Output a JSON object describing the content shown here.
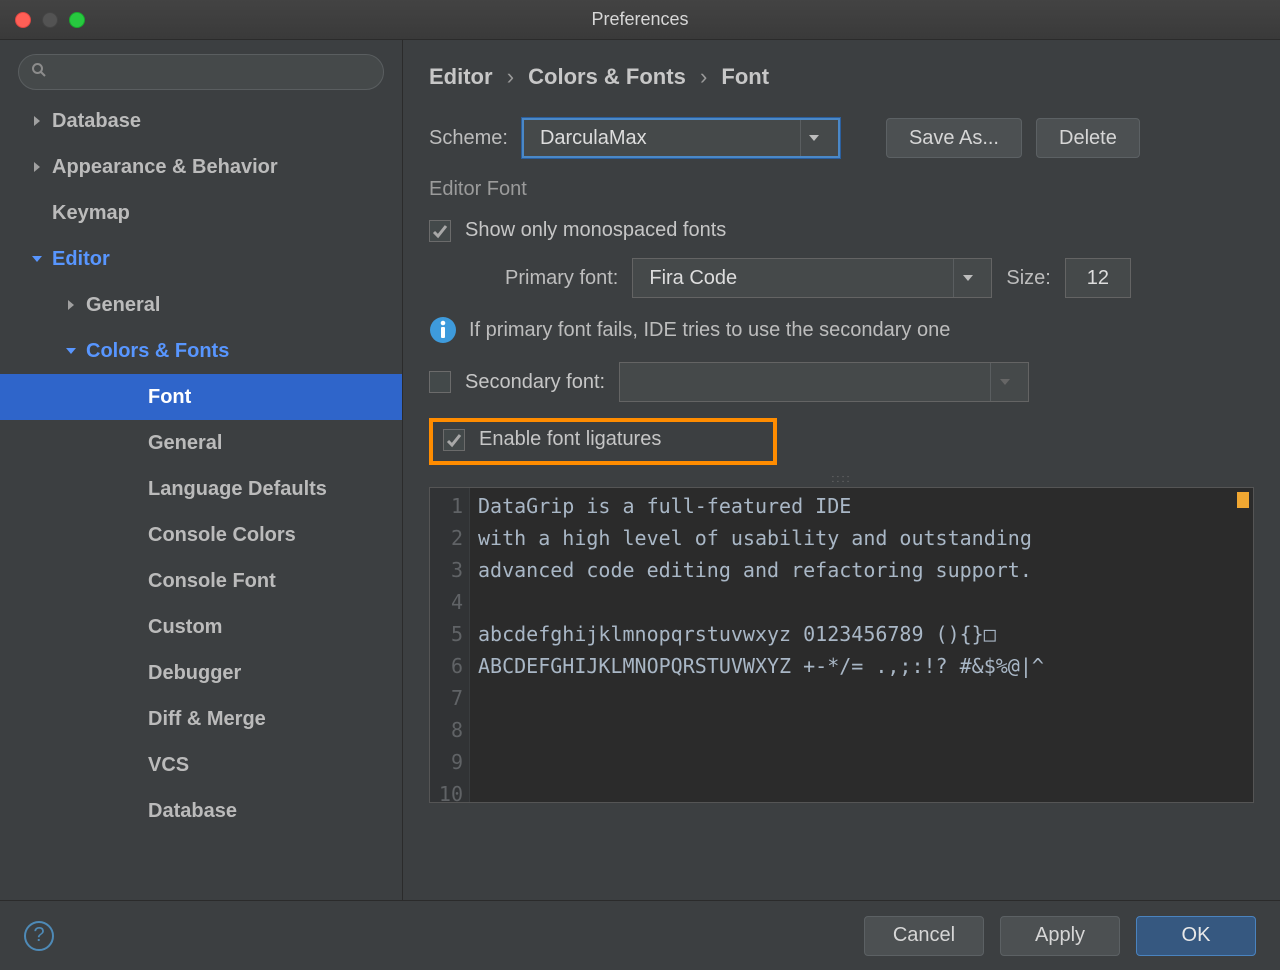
{
  "window": {
    "title": "Preferences"
  },
  "sidebar": {
    "search_placeholder": "",
    "items": [
      {
        "label": "Database",
        "level": 1,
        "arrow": "right"
      },
      {
        "label": "Appearance & Behavior",
        "level": 1,
        "arrow": "right"
      },
      {
        "label": "Keymap",
        "level": 1,
        "arrow": "none"
      },
      {
        "label": "Editor",
        "level": 1,
        "arrow": "down",
        "active_path": true
      },
      {
        "label": "General",
        "level": 2,
        "arrow": "right"
      },
      {
        "label": "Colors & Fonts",
        "level": 2,
        "arrow": "down",
        "active_path": true
      },
      {
        "label": "Font",
        "level": 3,
        "arrow": "none",
        "selected": true
      },
      {
        "label": "General",
        "level": 3,
        "arrow": "none"
      },
      {
        "label": "Language Defaults",
        "level": 3,
        "arrow": "none"
      },
      {
        "label": "Console Colors",
        "level": 3,
        "arrow": "none"
      },
      {
        "label": "Console Font",
        "level": 3,
        "arrow": "none"
      },
      {
        "label": "Custom",
        "level": 3,
        "arrow": "none"
      },
      {
        "label": "Debugger",
        "level": 3,
        "arrow": "none"
      },
      {
        "label": "Diff & Merge",
        "level": 3,
        "arrow": "none"
      },
      {
        "label": "VCS",
        "level": 3,
        "arrow": "none"
      },
      {
        "label": "Database",
        "level": 3,
        "arrow": "none"
      }
    ]
  },
  "breadcrumb": {
    "a": "Editor",
    "b": "Colors & Fonts",
    "c": "Font"
  },
  "scheme": {
    "label": "Scheme:",
    "value": "DarculaMax",
    "save_as": "Save As...",
    "delete": "Delete"
  },
  "editor_font": {
    "section_title": "Editor Font",
    "mono_only": "Show only monospaced fonts",
    "primary_label": "Primary font:",
    "primary_value": "Fira Code",
    "size_label": "Size:",
    "size_value": "12",
    "note": "If primary font fails, IDE tries to use the secondary one",
    "secondary_label": "Secondary font:",
    "secondary_value": "",
    "ligatures": "Enable font ligatures"
  },
  "preview": {
    "line_numbers": [
      "1",
      "2",
      "3",
      "4",
      "5",
      "6",
      "7",
      "8",
      "9",
      "10"
    ],
    "lines": [
      "DataGrip is a full-featured IDE",
      "with a high level of usability and outstanding",
      "advanced code editing and refactoring support.",
      "",
      "abcdefghijklmnopqrstuvwxyz 0123456789 (){}□",
      "ABCDEFGHIJKLMNOPQRSTUVWXYZ +-*/= .,;:!? #&$%@|^",
      "",
      "",
      "",
      ""
    ]
  },
  "footer": {
    "cancel": "Cancel",
    "apply": "Apply",
    "ok": "OK"
  }
}
